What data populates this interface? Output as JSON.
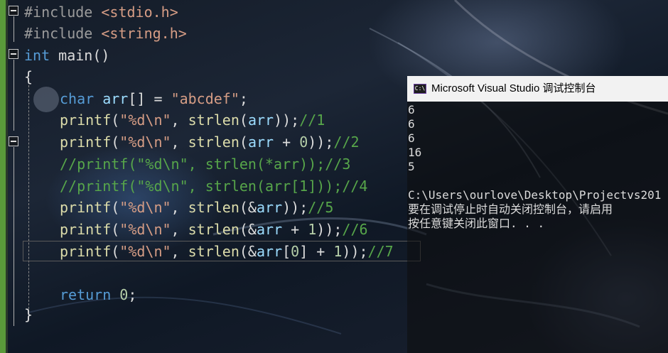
{
  "editor": {
    "lines": {
      "l1": [
        "#include ",
        "<stdio.h>"
      ],
      "l2": [
        "#include ",
        "<string.h>"
      ],
      "l3": [
        "int",
        " main()"
      ],
      "l4": [
        "{"
      ],
      "l5": [
        "char",
        " arr",
        "[] = ",
        "\"abcdef\"",
        ";"
      ],
      "l6": [
        "printf",
        "(",
        "\"%d\\n\"",
        ", ",
        "strlen",
        "(",
        "arr",
        "));",
        "//1"
      ],
      "l7": [
        "printf",
        "(",
        "\"%d\\n\"",
        ", ",
        "strlen",
        "(",
        "arr",
        " + ",
        "0",
        "));",
        "//2"
      ],
      "l8": [
        "//printf(\"%d\\n\", strlen(*arr));//3"
      ],
      "l9": [
        "//printf(\"%d\\n\", strlen(arr[1]));//4"
      ],
      "l10": [
        "printf",
        "(",
        "\"%d\\n\"",
        ", ",
        "strlen",
        "(&",
        "arr",
        "));",
        "//5"
      ],
      "l11": [
        "printf",
        "(",
        "\"%d\\n\"",
        ", ",
        "strlen",
        "(&",
        "arr",
        " + ",
        "1",
        "));",
        "//6"
      ],
      "l12": [
        "printf",
        "(",
        "\"%d\\n\"",
        ", ",
        "strlen",
        "(&",
        "arr",
        "[",
        "0",
        "] + ",
        "1",
        "));",
        "//7"
      ],
      "l13": [
        "return",
        " ",
        "0",
        ";"
      ],
      "l14": [
        "}"
      ]
    }
  },
  "console": {
    "title": "Microsoft Visual Studio 调试控制台",
    "icon_label": "C:\\",
    "output": [
      "6",
      "6",
      "6",
      "16",
      "5",
      "",
      "C:\\Users\\ourlove\\Desktop\\Projectvs201",
      "要在调试停止时自动关闭控制台，请启用",
      "按任意键关闭此窗口. . ."
    ]
  },
  "colors": {
    "keyword": "#569cd6",
    "string": "#d69d85",
    "comment": "#57a64a",
    "function": "#dcdcaa",
    "number": "#b5cea8",
    "variable": "#9cdcfe",
    "margin_green": "#5a9a3a"
  }
}
